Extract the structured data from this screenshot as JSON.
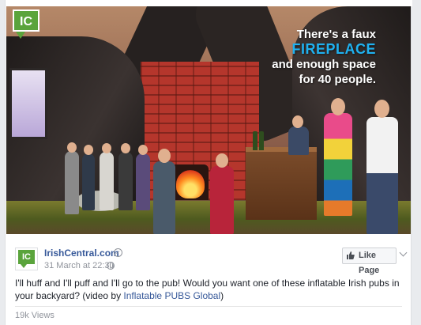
{
  "video": {
    "logo_text": "IC",
    "caption": {
      "line1": "There's a faux",
      "highlight": "FIREPLACE",
      "line3": "and enough space",
      "line4": "for 40 people."
    }
  },
  "post": {
    "avatar_text": "IC",
    "page_name": "IrishCentral.com",
    "timestamp": "31 March at 22:30",
    "like_button_label": "Like Page",
    "text_main": "I'll huff and I'll puff and I'll go to the pub! Would you want one of these inflatable Irish pubs in your backyard? (video by ",
    "text_link": "Inflatable PUBS Global",
    "text_end": ")",
    "views": "19k Views"
  },
  "colors": {
    "brand_green": "#5aa43c",
    "link_blue": "#365899",
    "caption_highlight": "#1fb2f1"
  },
  "icons": {
    "verified": "verified-check-icon",
    "privacy": "globe-icon",
    "like": "thumbs-up-icon",
    "menu": "chevron-down-icon"
  }
}
